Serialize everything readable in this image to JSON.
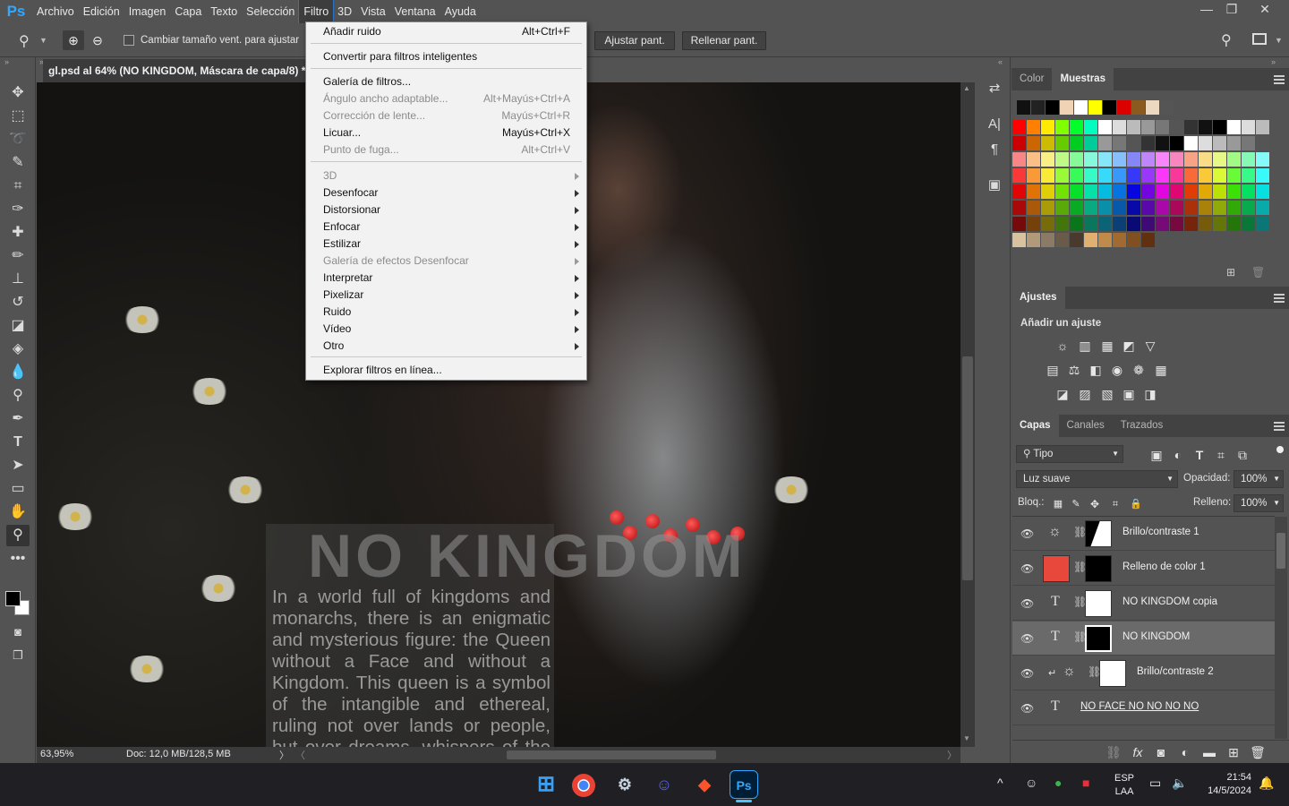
{
  "app": {
    "logo": "Ps"
  },
  "menubar": {
    "items": [
      "Archivo",
      "Edición",
      "Imagen",
      "Capa",
      "Texto",
      "Selección",
      "Filtro",
      "3D",
      "Vista",
      "Ventana",
      "Ayuda"
    ]
  },
  "window": {
    "minimize": "—",
    "restore": "❐",
    "close": "✕"
  },
  "options": {
    "resize_checkbox_label": "Cambiar tamaño vent. para ajustar",
    "fit_button": "Ajustar pant.",
    "fill_button": "Rellenar pant."
  },
  "document": {
    "tab_title": "gl.psd al 64% (NO KINGDOM, Máscara de capa/8) *",
    "zoom_status": "63,95%",
    "doc_status": "Doc: 12,0 MB/128,5 MB",
    "title_text": "NO KINGDOM",
    "body_text": "In a world full of kingdoms and monarchs, there is an enigmatic and mysterious figure: the Queen without a Face and without a Kingdom. This queen is a symbol of the intangible and ethereal, ruling not over lands or people, but over dreams, whispers of the wind and unrevealed secrets."
  },
  "filter_menu": {
    "items": [
      {
        "label": "Añadir ruido",
        "shortcut": "Alt+Ctrl+F",
        "disabled": false
      },
      {
        "label": "Convertir para filtros inteligentes",
        "shortcut": "",
        "disabled": false
      },
      {
        "label": "Galería de filtros...",
        "shortcut": "",
        "disabled": false
      },
      {
        "label": "Ángulo ancho adaptable...",
        "shortcut": "Alt+Mayús+Ctrl+A",
        "disabled": true
      },
      {
        "label": "Corrección de lente...",
        "shortcut": "Mayús+Ctrl+R",
        "disabled": true
      },
      {
        "label": "Licuar...",
        "shortcut": "Mayús+Ctrl+X",
        "disabled": false
      },
      {
        "label": "Punto de fuga...",
        "shortcut": "Alt+Ctrl+V",
        "disabled": true
      },
      {
        "label": "3D",
        "shortcut": "",
        "disabled": true
      },
      {
        "label": "Desenfocar",
        "shortcut": "",
        "disabled": false
      },
      {
        "label": "Distorsionar",
        "shortcut": "",
        "disabled": false
      },
      {
        "label": "Enfocar",
        "shortcut": "",
        "disabled": false
      },
      {
        "label": "Estilizar",
        "shortcut": "",
        "disabled": false
      },
      {
        "label": "Galería de efectos Desenfocar",
        "shortcut": "",
        "disabled": true
      },
      {
        "label": "Interpretar",
        "shortcut": "",
        "disabled": false
      },
      {
        "label": "Pixelizar",
        "shortcut": "",
        "disabled": false
      },
      {
        "label": "Ruido",
        "shortcut": "",
        "disabled": false
      },
      {
        "label": "Vídeo",
        "shortcut": "",
        "disabled": false
      },
      {
        "label": "Otro",
        "shortcut": "",
        "disabled": false
      },
      {
        "label": "Explorar filtros en línea...",
        "shortcut": "",
        "disabled": false
      }
    ]
  },
  "swatches_panel": {
    "tabs": [
      "Color",
      "Muestras"
    ]
  },
  "adjustments_panel": {
    "title": "Ajustes",
    "subtitle": "Añadir un ajuste"
  },
  "layers_panel": {
    "tabs": [
      "Capas",
      "Canales",
      "Trazados"
    ],
    "filter_kind": "Tipo",
    "blend_mode": "Luz suave",
    "opacity_label": "Opacidad:",
    "opacity_value": "100%",
    "lock_label": "Bloq.:",
    "fill_label": "Relleno:",
    "fill_value": "100%",
    "layers": [
      {
        "name": "Brillo/contraste 1",
        "kind": "adjustment",
        "selected": false
      },
      {
        "name": "Relleno de color 1",
        "kind": "fill",
        "selected": false
      },
      {
        "name": "NO KINGDOM copia",
        "kind": "text",
        "selected": false
      },
      {
        "name": "NO KINGDOM",
        "kind": "text",
        "selected": true
      },
      {
        "name": "Brillo/contraste 2",
        "kind": "adjustment",
        "selected": false
      },
      {
        "name": "NO FACE NO  NO NO NO ",
        "kind": "text",
        "selected": false
      }
    ]
  },
  "taskbar": {
    "lang": "ESP",
    "region": "LAA",
    "time": "21:54",
    "date": "14/5/2024"
  },
  "colors": {
    "accent": "#31a8ff",
    "menu_highlight": "#2a73c9",
    "fill_layer_color": "#e8483c"
  }
}
